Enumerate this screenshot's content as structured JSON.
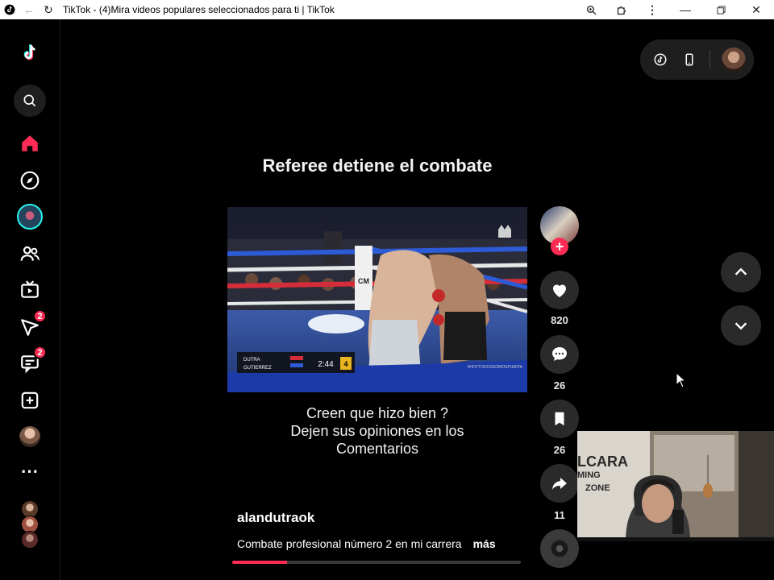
{
  "window": {
    "title": "TikTok - (4)Mira videos populares seleccionados para ti | TikTok"
  },
  "sidebar": {
    "notifications_badge": "2",
    "messages_badge": "2"
  },
  "video": {
    "overlay_title": "Referee detiene el combate",
    "caption_lines": [
      "Creen que hizo bien ?",
      "Dejen sus opiniones en los",
      "Comentarios"
    ],
    "scoreboard": {
      "fighter_1": "DUTRA",
      "fighter_2": "GUTIERREZ",
      "clock": "2:44",
      "round": "4"
    },
    "watermark": "#HOYTODOSSOMOSPUMITA",
    "corner_logo": "CM",
    "progress": 0.19
  },
  "post": {
    "username": "alandutraok",
    "description": "Combate profesional número 2 en mi carrera",
    "more_label": "más"
  },
  "actions": {
    "likes": "820",
    "comments": "26",
    "saves": "26",
    "shares": "11"
  },
  "webcam": {
    "wall_text_1": "LCARA",
    "wall_text_2": "MING",
    "wall_text_3": "ZONE"
  },
  "colors": {
    "accent": "#fe2c55",
    "background": "#000000",
    "button_bg": "#2a2a2a"
  }
}
